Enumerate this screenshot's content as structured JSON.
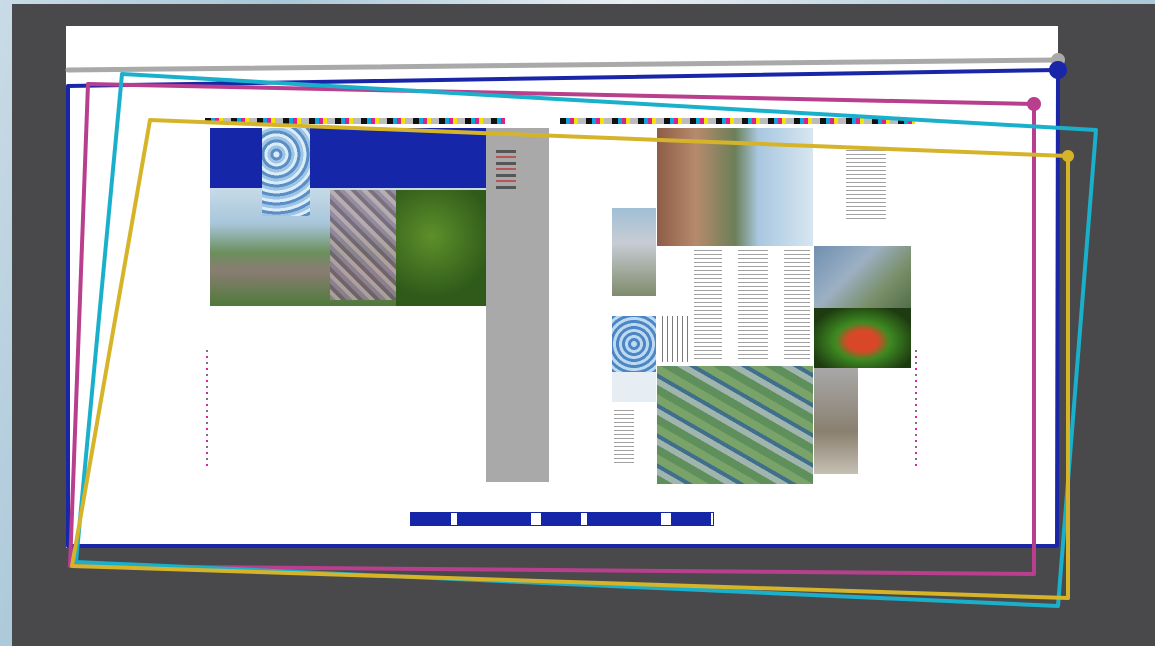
{
  "canvas": {
    "background": "#4a4a4c"
  },
  "sheet": {
    "slug_text": ""
  },
  "overlay": {
    "colors": {
      "gray": "#a9a9a9",
      "navy": "#1a26a8",
      "magenta": "#b83e8e",
      "cyan": "#1ab0cc",
      "gold": "#d6b42a"
    }
  }
}
